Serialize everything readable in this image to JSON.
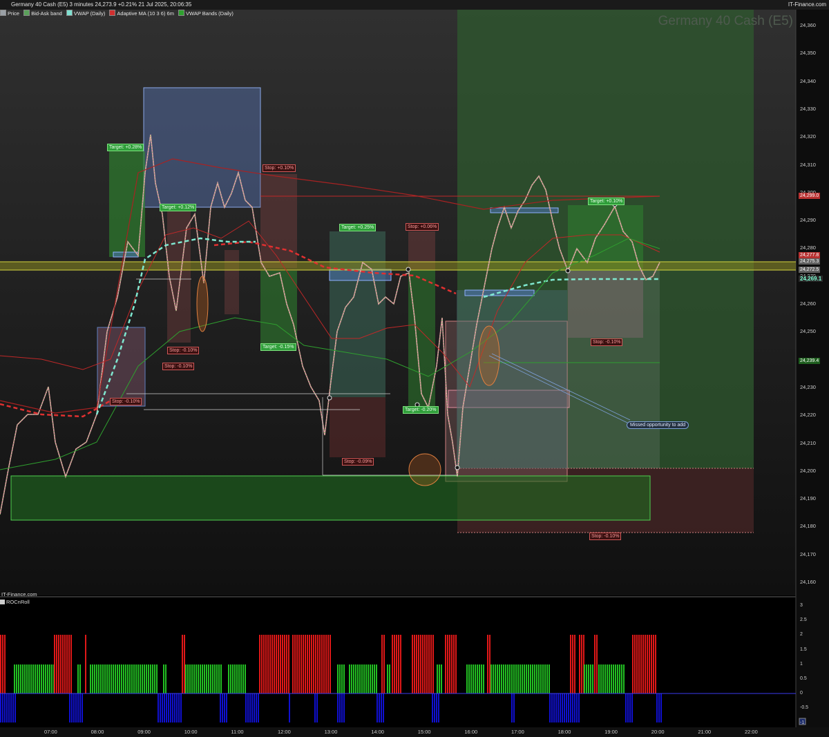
{
  "header": {
    "title": "Germany 40 Cash (E5) 3 minutes 24,273.9 +0.21% 21 Jul 2025, 20:06:35",
    "site": "IT-Finance.com",
    "watermark": "Germany 40 Cash (E5)",
    "sub_watermark": "IT-Finance.com"
  },
  "legend": [
    {
      "label": "Price",
      "color": "#9aa0a6"
    },
    {
      "label": "Bid-Ask band",
      "color": "#5aa05a"
    },
    {
      "label": "VWAP (Daily)",
      "color": "#7fe0d0"
    },
    {
      "label": "Adaptive MA (10 3 6) 6m",
      "color": "#d03030"
    },
    {
      "label": "VWAP Bands (Daily)",
      "color": "#2fa02f"
    }
  ],
  "indicator": {
    "name": "ROCnRoll",
    "ticks": [
      "3",
      "2.5",
      "2",
      "1.5",
      "1",
      "0.5",
      "0",
      "-0.5",
      "-1"
    ]
  },
  "price_axis": {
    "ticks": [
      "24,360",
      "24,350",
      "24,340",
      "24,330",
      "24,320",
      "24,310",
      "24,300",
      "24,290",
      "24,280",
      "24,270",
      "24,260",
      "24,250",
      "24,240",
      "24,230",
      "24,220",
      "24,210",
      "24,200",
      "24,190",
      "24,180",
      "24,170",
      "24,160"
    ],
    "tags": [
      {
        "text": "24,299.0",
        "color": "#b83030"
      },
      {
        "text": "24,277.8",
        "color": "#b83030"
      },
      {
        "text": "24,275.3",
        "color": "#606060"
      },
      {
        "text": "24,272.5",
        "color": "#606060"
      },
      {
        "text": "24,269.1",
        "color": "#2a2a2a"
      },
      {
        "text": "24,239.4",
        "color": "#1e5e1e"
      }
    ]
  },
  "time_axis": [
    "07:00",
    "08:00",
    "09:00",
    "10:00",
    "11:00",
    "12:00",
    "13:00",
    "14:00",
    "15:00",
    "16:00",
    "17:00",
    "18:00",
    "19:00",
    "20:00",
    "21:00",
    "22:00"
  ],
  "trade_labels": {
    "targets": [
      "Target: +0.28%",
      "Target: +0.12%",
      "Target: -0.15%",
      "Target: +0.25%",
      "Target: -0.20%",
      "Target: +0.10%"
    ],
    "stops": [
      "Stop: -0.10%",
      "Stop: -0.10%",
      "Stop: -0.10%",
      "Stop: +0.10%",
      "Stop: -0.09%",
      "Stop: +0.06%",
      "Stop: -0.10%",
      "Stop: -0.10%"
    ]
  },
  "annotation": "Missed opportunity to add"
}
